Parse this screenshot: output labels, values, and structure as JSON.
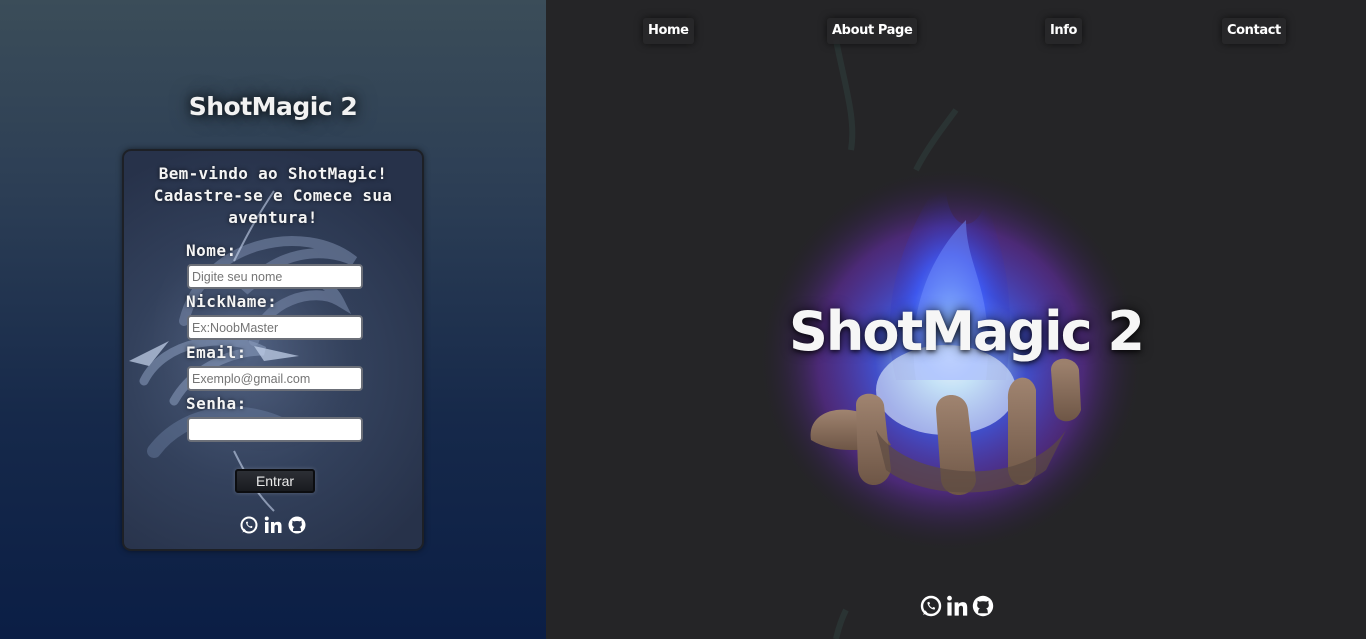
{
  "sidebar": {
    "title": "ShotMagic 2",
    "heading": [
      "Bem-vindo ao ShotMagic!",
      "Cadastre-se e Comece sua",
      "aventura!"
    ],
    "fields": [
      {
        "label": "Nome:",
        "placeholder": "Digite seu nome",
        "value": ""
      },
      {
        "label": "NickName:",
        "placeholder": "Ex:NoobMaster",
        "value": ""
      },
      {
        "label": "Email:",
        "placeholder": "Exemplo@gmail.com",
        "value": ""
      },
      {
        "label": "Senha:",
        "placeholder": "",
        "value": ""
      }
    ],
    "submit_label": "Entrar",
    "socials": [
      "whatsapp-icon",
      "linkedin-icon",
      "github-icon"
    ]
  },
  "nav": {
    "items": [
      {
        "label": "Home"
      },
      {
        "label": "About Page"
      },
      {
        "label": "Info"
      },
      {
        "label": "Contact"
      }
    ]
  },
  "hero": {
    "title": "ShotMagic 2",
    "socials": [
      "whatsapp-icon",
      "linkedin-icon",
      "github-icon"
    ]
  },
  "colors": {
    "left_top": "#3b4d59",
    "left_bottom": "#0b1e45",
    "right_bg": "#252527",
    "magic_blue": "#3a6bff",
    "magic_purple": "#8a3cff"
  }
}
